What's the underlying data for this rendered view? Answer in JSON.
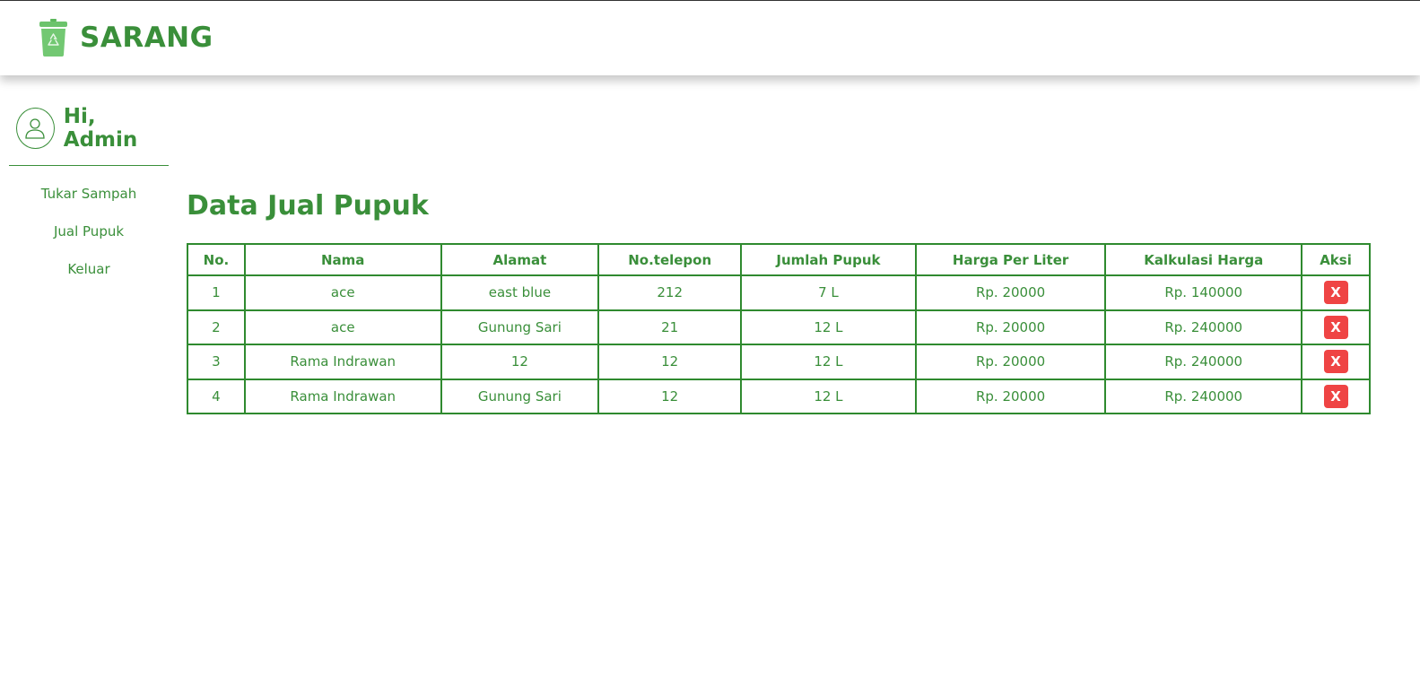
{
  "header": {
    "brand": "SARANG",
    "logo_icon": "recycle-bin-icon"
  },
  "sidebar": {
    "greeting": "Hi, Admin",
    "avatar_icon": "user-icon",
    "items": [
      {
        "label": "Tukar Sampah"
      },
      {
        "label": "Jual Pupuk"
      },
      {
        "label": "Keluar"
      }
    ]
  },
  "main": {
    "title": "Data Jual Pupuk",
    "table": {
      "headers": [
        "No.",
        "Nama",
        "Alamat",
        "No.telepon",
        "Jumlah Pupuk",
        "Harga Per Liter",
        "Kalkulasi Harga",
        "Aksi"
      ],
      "rows": [
        {
          "no": "1",
          "nama": "ace",
          "alamat": "east blue",
          "telepon": "212",
          "jumlah": "7 L",
          "harga": "Rp. 20000",
          "kalkulasi": "Rp. 140000",
          "aksi": "X"
        },
        {
          "no": "2",
          "nama": "ace",
          "alamat": "Gunung Sari",
          "telepon": "21",
          "jumlah": "12 L",
          "harga": "Rp. 20000",
          "kalkulasi": "Rp. 240000",
          "aksi": "X"
        },
        {
          "no": "3",
          "nama": "Rama Indrawan",
          "alamat": "12",
          "telepon": "12",
          "jumlah": "12 L",
          "harga": "Rp. 20000",
          "kalkulasi": "Rp. 240000",
          "aksi": "X"
        },
        {
          "no": "4",
          "nama": "Rama Indrawan",
          "alamat": "Gunung Sari",
          "telepon": "12",
          "jumlah": "12 L",
          "harga": "Rp. 20000",
          "kalkulasi": "Rp. 240000",
          "aksi": "X"
        }
      ]
    }
  },
  "colors": {
    "accent": "#3a8f3a",
    "border": "#2f8a2f",
    "delete": "#ef4444"
  }
}
